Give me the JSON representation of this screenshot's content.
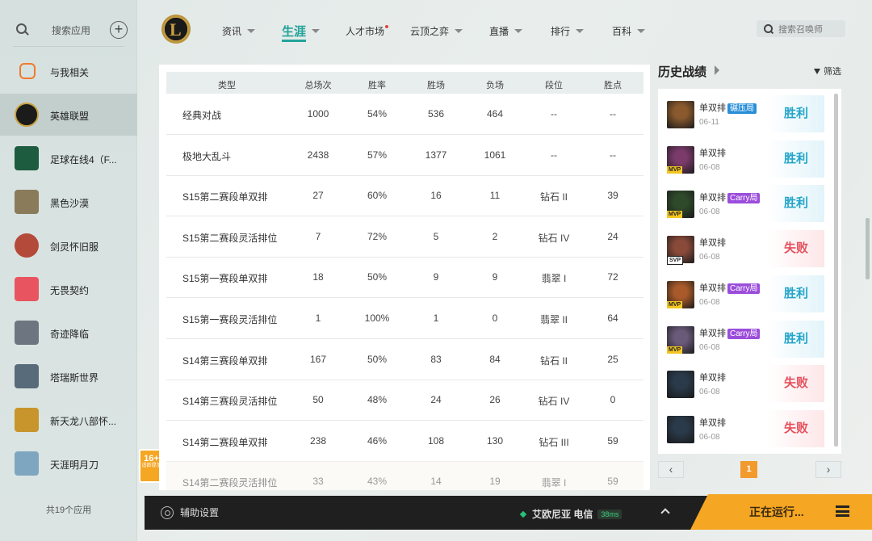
{
  "sidebar": {
    "search_label": "搜索应用",
    "items": [
      {
        "label": "与我相关",
        "icon": "game-controller-icon",
        "color": "#f07a2e"
      },
      {
        "label": "英雄联盟",
        "icon": "league-of-legends-icon",
        "color": "#1b1b1b"
      },
      {
        "label": "足球在线4（F...",
        "icon": "fc-online-icon",
        "color": "#1d5c3f"
      },
      {
        "label": "黑色沙漠",
        "icon": "black-desert-icon",
        "color": "#8a7b5a"
      },
      {
        "label": "剑灵怀旧服",
        "icon": "blade-soul-icon",
        "color": "#b44a3a"
      },
      {
        "label": "无畏契约",
        "icon": "valorant-icon",
        "color": "#e85560"
      },
      {
        "label": "奇迹降临",
        "icon": "mu-icon",
        "color": "#6d7680"
      },
      {
        "label": "塔瑞斯世界",
        "icon": "tarisland-icon",
        "color": "#586b7a"
      },
      {
        "label": "新天龙八部怀...",
        "icon": "tlbb-icon",
        "color": "#c8952c"
      },
      {
        "label": "天涯明月刀",
        "icon": "moonlight-blade-icon",
        "color": "#7fa6c0"
      }
    ],
    "footer": "共19个应用"
  },
  "age_rating": {
    "number": "16+",
    "label": "适龄提示"
  },
  "nav": {
    "items": [
      {
        "label": "资讯",
        "caret": true,
        "dot": false
      },
      {
        "label": "生涯",
        "caret": true,
        "dot": false,
        "active": true
      },
      {
        "label": "人才市场",
        "caret": false,
        "dot": true
      },
      {
        "label": "云顶之弈",
        "caret": true,
        "dot": false
      },
      {
        "label": "直播",
        "caret": true,
        "dot": false
      },
      {
        "label": "排行",
        "caret": true,
        "dot": false
      },
      {
        "label": "百科",
        "caret": true,
        "dot": false
      }
    ],
    "search_placeholder": "搜索召唤师"
  },
  "stats_table": {
    "headers": [
      "类型",
      "总场次",
      "胜率",
      "胜场",
      "负场",
      "段位",
      "胜点"
    ],
    "rows": [
      [
        "经典对战",
        "1000",
        "54%",
        "536",
        "464",
        "--",
        "--"
      ],
      [
        "极地大乱斗",
        "2438",
        "57%",
        "1377",
        "1061",
        "--",
        "--"
      ],
      [
        "S15第二赛段单双排",
        "27",
        "60%",
        "16",
        "11",
        "钻石 II",
        "39"
      ],
      [
        "S15第二赛段灵活排位",
        "7",
        "72%",
        "5",
        "2",
        "钻石 IV",
        "24"
      ],
      [
        "S15第一赛段单双排",
        "18",
        "50%",
        "9",
        "9",
        "翡翠 I",
        "72"
      ],
      [
        "S15第一赛段灵活排位",
        "1",
        "100%",
        "1",
        "0",
        "翡翠 II",
        "64"
      ],
      [
        "S14第三赛段单双排",
        "167",
        "50%",
        "83",
        "84",
        "钻石 II",
        "25"
      ],
      [
        "S14第三赛段灵活排位",
        "50",
        "48%",
        "24",
        "26",
        "钻石 IV",
        "0"
      ],
      [
        "S14第二赛段单双排",
        "238",
        "46%",
        "108",
        "130",
        "钻石 III",
        "59"
      ],
      [
        "S14第二赛段灵活排位",
        "33",
        "43%",
        "14",
        "19",
        "翡翠 I",
        "59"
      ]
    ]
  },
  "history": {
    "title": "历史战绩",
    "filter_label": "筛选",
    "items": [
      {
        "mode": "单双排",
        "tag": "碾压局",
        "tag_color": "#2a8fd8",
        "date": "06-11",
        "badge": "",
        "result": "胜利",
        "win": true,
        "champ_color": "#8a5a2e"
      },
      {
        "mode": "单双排",
        "tag": "",
        "tag_color": "",
        "date": "06-08",
        "badge": "MVP",
        "result": "胜利",
        "win": true,
        "champ_color": "#7a3a6a"
      },
      {
        "mode": "单双排",
        "tag": "Carry局",
        "tag_color": "#9b4ddb",
        "date": "06-08",
        "badge": "MVP",
        "result": "胜利",
        "win": true,
        "champ_color": "#2e4a2a"
      },
      {
        "mode": "单双排",
        "tag": "",
        "tag_color": "",
        "date": "06-08",
        "badge": "SVP",
        "result": "失败",
        "win": false,
        "champ_color": "#8a4a3a"
      },
      {
        "mode": "单双排",
        "tag": "Carry局",
        "tag_color": "#9b4ddb",
        "date": "06-08",
        "badge": "MVP",
        "result": "胜利",
        "win": true,
        "champ_color": "#a85a2a"
      },
      {
        "mode": "单双排",
        "tag": "Carry局",
        "tag_color": "#9b4ddb",
        "date": "06-08",
        "badge": "MVP",
        "result": "胜利",
        "win": true,
        "champ_color": "#6a5a7a"
      },
      {
        "mode": "单双排",
        "tag": "",
        "tag_color": "",
        "date": "06-08",
        "badge": "",
        "result": "失败",
        "win": false,
        "champ_color": "#2a3a4a"
      },
      {
        "mode": "单双排",
        "tag": "",
        "tag_color": "",
        "date": "06-08",
        "badge": "",
        "result": "失败",
        "win": false,
        "champ_color": "#2a3a4a"
      }
    ],
    "page": "1"
  },
  "bottom_bar": {
    "assist_label": "辅助设置",
    "server_name": "艾欧尼亚 电信",
    "ping": "38ms",
    "running_label": "正在运行..."
  }
}
